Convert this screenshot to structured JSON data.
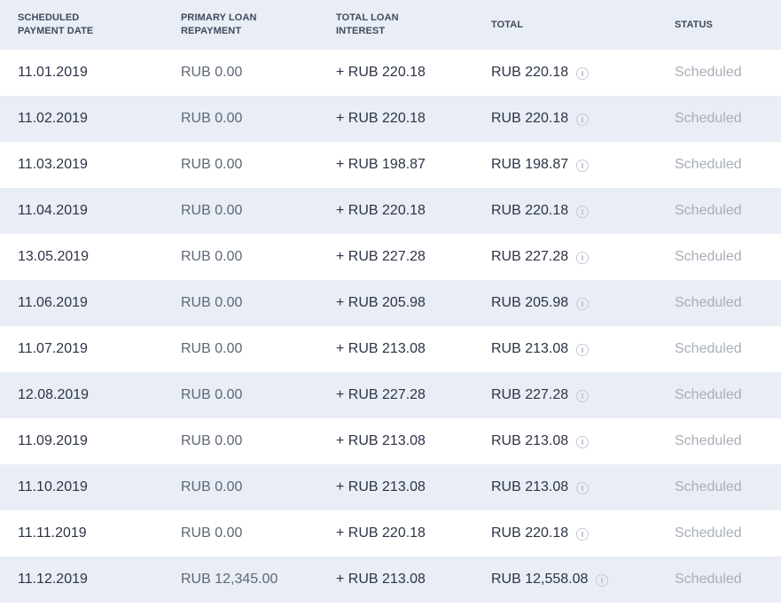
{
  "header": {
    "date": "SCHEDULED\nPAYMENT DATE",
    "primary": "PRIMARY LOAN\nREPAYMENT",
    "interest": "TOTAL LOAN\nINTEREST",
    "total": "TOTAL",
    "status": "STATUS"
  },
  "rows": [
    {
      "date": "11.01.2019",
      "primary": "RUB 0.00",
      "interest": "+ RUB 220.18",
      "total": "RUB 220.18",
      "status": "Scheduled"
    },
    {
      "date": "11.02.2019",
      "primary": "RUB 0.00",
      "interest": "+ RUB 220.18",
      "total": "RUB 220.18",
      "status": "Scheduled"
    },
    {
      "date": "11.03.2019",
      "primary": "RUB 0.00",
      "interest": "+ RUB 198.87",
      "total": "RUB 198.87",
      "status": "Scheduled"
    },
    {
      "date": "11.04.2019",
      "primary": "RUB 0.00",
      "interest": "+ RUB 220.18",
      "total": "RUB 220.18",
      "status": "Scheduled"
    },
    {
      "date": "13.05.2019",
      "primary": "RUB 0.00",
      "interest": "+ RUB 227.28",
      "total": "RUB 227.28",
      "status": "Scheduled"
    },
    {
      "date": "11.06.2019",
      "primary": "RUB 0.00",
      "interest": "+ RUB 205.98",
      "total": "RUB 205.98",
      "status": "Scheduled"
    },
    {
      "date": "11.07.2019",
      "primary": "RUB 0.00",
      "interest": "+ RUB 213.08",
      "total": "RUB 213.08",
      "status": "Scheduled"
    },
    {
      "date": "12.08.2019",
      "primary": "RUB 0.00",
      "interest": "+ RUB 227.28",
      "total": "RUB 227.28",
      "status": "Scheduled"
    },
    {
      "date": "11.09.2019",
      "primary": "RUB 0.00",
      "interest": "+ RUB 213.08",
      "total": "RUB 213.08",
      "status": "Scheduled"
    },
    {
      "date": "11.10.2019",
      "primary": "RUB 0.00",
      "interest": "+ RUB 213.08",
      "total": "RUB 213.08",
      "status": "Scheduled"
    },
    {
      "date": "11.11.2019",
      "primary": "RUB 0.00",
      "interest": "+ RUB 220.18",
      "total": "RUB 220.18",
      "status": "Scheduled"
    },
    {
      "date": "11.12.2019",
      "primary": "RUB 12,345.00",
      "interest": "+ RUB 213.08",
      "total": "RUB 12,558.08",
      "status": "Scheduled"
    }
  ],
  "icons": {
    "total_info": "info-icon"
  },
  "colors": {
    "header_bg": "#e9edf5",
    "stripe_bg": "#e9edf5",
    "status_text": "#a8aeb8"
  }
}
